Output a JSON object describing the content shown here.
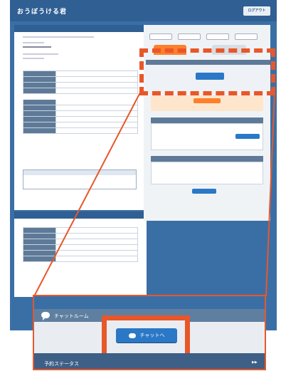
{
  "app": {
    "logo": "おうぼうける君",
    "logout_label": "ログアウト"
  },
  "zoom": {
    "panel_title": "チャットルーム",
    "chat_button_label": "チャットへ",
    "footer_label": "予約ステータス"
  },
  "colors": {
    "accent_orange": "#e8572a",
    "header_blue": "#2f5f93",
    "button_blue": "#2a78c6"
  },
  "icons": [
    "chat-bubble-icon",
    "chevron-right-icon"
  ]
}
